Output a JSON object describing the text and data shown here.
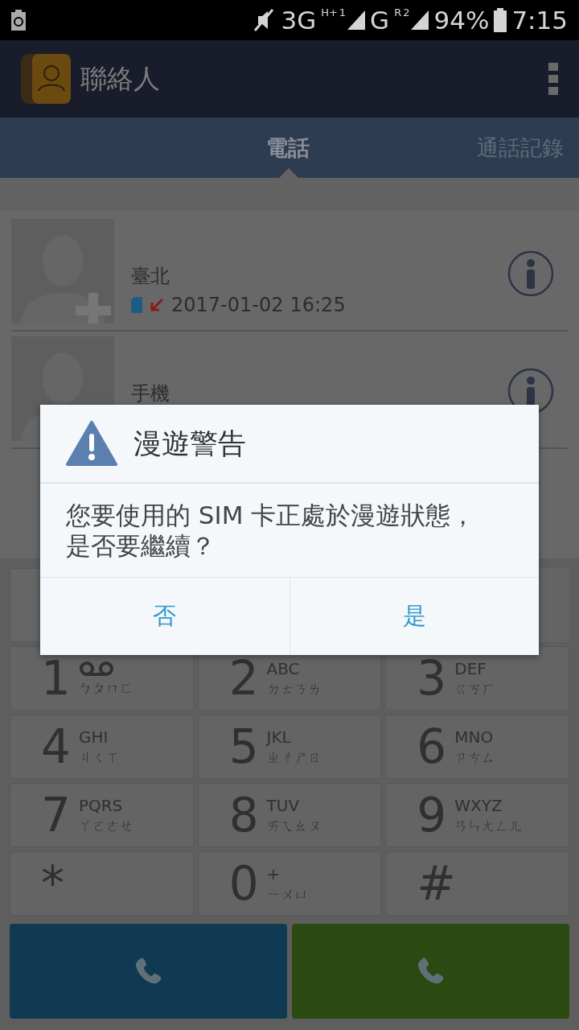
{
  "status_bar": {
    "network_1": "3G",
    "network_1_badge": "H+",
    "sim_1": "1",
    "network_2": "G",
    "network_2_badge": "R",
    "sim_2": "2",
    "battery": "94%",
    "time": "7:15"
  },
  "app_bar": {
    "title": "聯絡人"
  },
  "tabs": [
    {
      "label": "電話",
      "selected": true
    },
    {
      "label": "通話記錄",
      "selected": false
    }
  ],
  "call_log": [
    {
      "saved": false,
      "info": true,
      "label": "臺北",
      "date": "2017-01-02",
      "time": "16:25"
    },
    {
      "info": true,
      "label": "手機"
    }
  ],
  "dialpad": [
    {
      "digit": "1",
      "kind": "voicemail",
      "bopomofo": "ㄅㄆㄇㄈ"
    },
    {
      "digit": "2",
      "kind": "letters",
      "letters": "ABC",
      "bopomofo": "ㄉㄊㄋㄌ"
    },
    {
      "digit": "3",
      "kind": "letters",
      "letters": "DEF",
      "bopomofo": "ㄍㄎㄏ"
    },
    {
      "digit": "4",
      "kind": "letters",
      "letters": "GHI",
      "bopomofo": "ㄐㄑㄒ"
    },
    {
      "digit": "5",
      "kind": "letters",
      "letters": "JKL",
      "bopomofo": "ㄓㄔㄕㄖ"
    },
    {
      "digit": "6",
      "kind": "letters",
      "letters": "MNO",
      "bopomofo": "ㄗㄘㄙ"
    },
    {
      "digit": "7",
      "kind": "letters",
      "letters": "PQRS",
      "bopomofo": "ㄚㄛㄜㄝ"
    },
    {
      "digit": "8",
      "kind": "letters",
      "letters": "TUV",
      "bopomofo": "ㄞㄟㄠㄡ"
    },
    {
      "digit": "9",
      "kind": "letters",
      "letters": "WXYZ",
      "bopomofo": "ㄢㄣㄤㄥㄦ"
    },
    {
      "digit": "*",
      "kind": "symbol"
    },
    {
      "digit": "0",
      "kind": "letters",
      "letters": "+",
      "bopomofo": "ㄧㄨㄩ"
    },
    {
      "digit": "#",
      "kind": "symbol"
    }
  ],
  "call_buttons": [
    {
      "color": "#0f3a52"
    },
    {
      "color": "#2b4a12"
    }
  ],
  "dialog": {
    "title": "漫遊警告",
    "message": "您要使用的 SIM 卡正處於漫遊狀態，是否要繼續？",
    "buttons": [
      "否",
      "是"
    ]
  }
}
